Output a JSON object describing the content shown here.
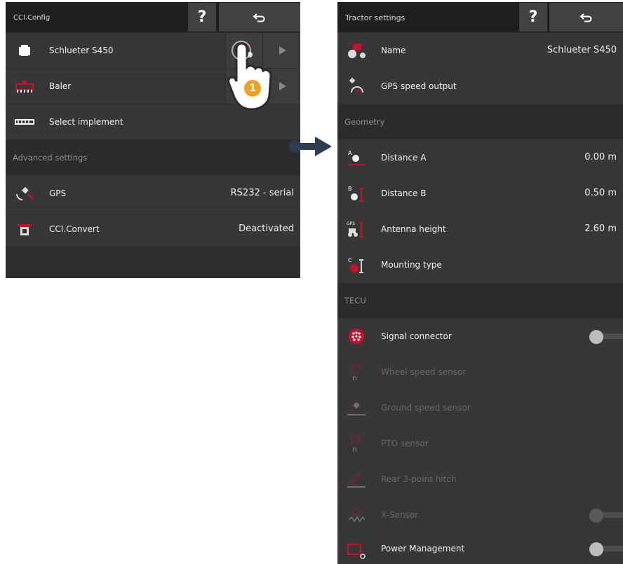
{
  "left": {
    "title": "CCI.Config",
    "help_label": "?",
    "back_icon": "undo-arrow-icon",
    "rows": [
      {
        "label": "Schlueter S450",
        "icon": "tractor-icon"
      },
      {
        "label": "Baler",
        "icon": "baler-icon"
      },
      {
        "label": "Select implement",
        "icon": "implement-icon"
      }
    ],
    "advanced_header": "Advanced settings",
    "gps": {
      "label": "GPS",
      "value": "RS232 - serial"
    },
    "convert": {
      "label": "CCI.Convert",
      "value": "Deactivated"
    }
  },
  "callout_number": "1",
  "right": {
    "title": "Tractor settings",
    "help_label": "?",
    "name": {
      "label": "Name",
      "value": "Schlueter S450"
    },
    "gps_speed": {
      "label": "GPS speed output"
    },
    "geometry_header": "Geometry",
    "distance_a": {
      "label": "Distance A",
      "value": "0.00 m",
      "icon_letter": "A"
    },
    "distance_b": {
      "label": "Distance B",
      "value": "0.50 m",
      "icon_letter": "B"
    },
    "antenna": {
      "label": "Antenna height",
      "value": "2.60 m",
      "icon_letter": "GPS"
    },
    "mounting": {
      "label": "Mounting type",
      "icon_letter": "C"
    },
    "tecu_header": "TECU",
    "signal_connector": {
      "label": "Signal connector",
      "toggle": "off"
    },
    "wheel_speed": {
      "label": "Wheel speed sensor",
      "disabled": true,
      "icon_letter": "n"
    },
    "ground_speed": {
      "label": "Ground speed sensor",
      "disabled": true
    },
    "pto": {
      "label": "PTO sensor",
      "disabled": true,
      "icon_letter": "n"
    },
    "rear_hitch": {
      "label": "Rear 3-point hitch",
      "disabled": true
    },
    "x_sensor": {
      "label": "X-Sensor",
      "disabled": true,
      "toggle": "off"
    },
    "power_mgmt": {
      "label": "Power Management",
      "toggle": "off"
    }
  },
  "colors": {
    "accent_red": "#c8102e",
    "badge_orange": "#f0a020",
    "arrow_blue": "#2f3d52"
  }
}
